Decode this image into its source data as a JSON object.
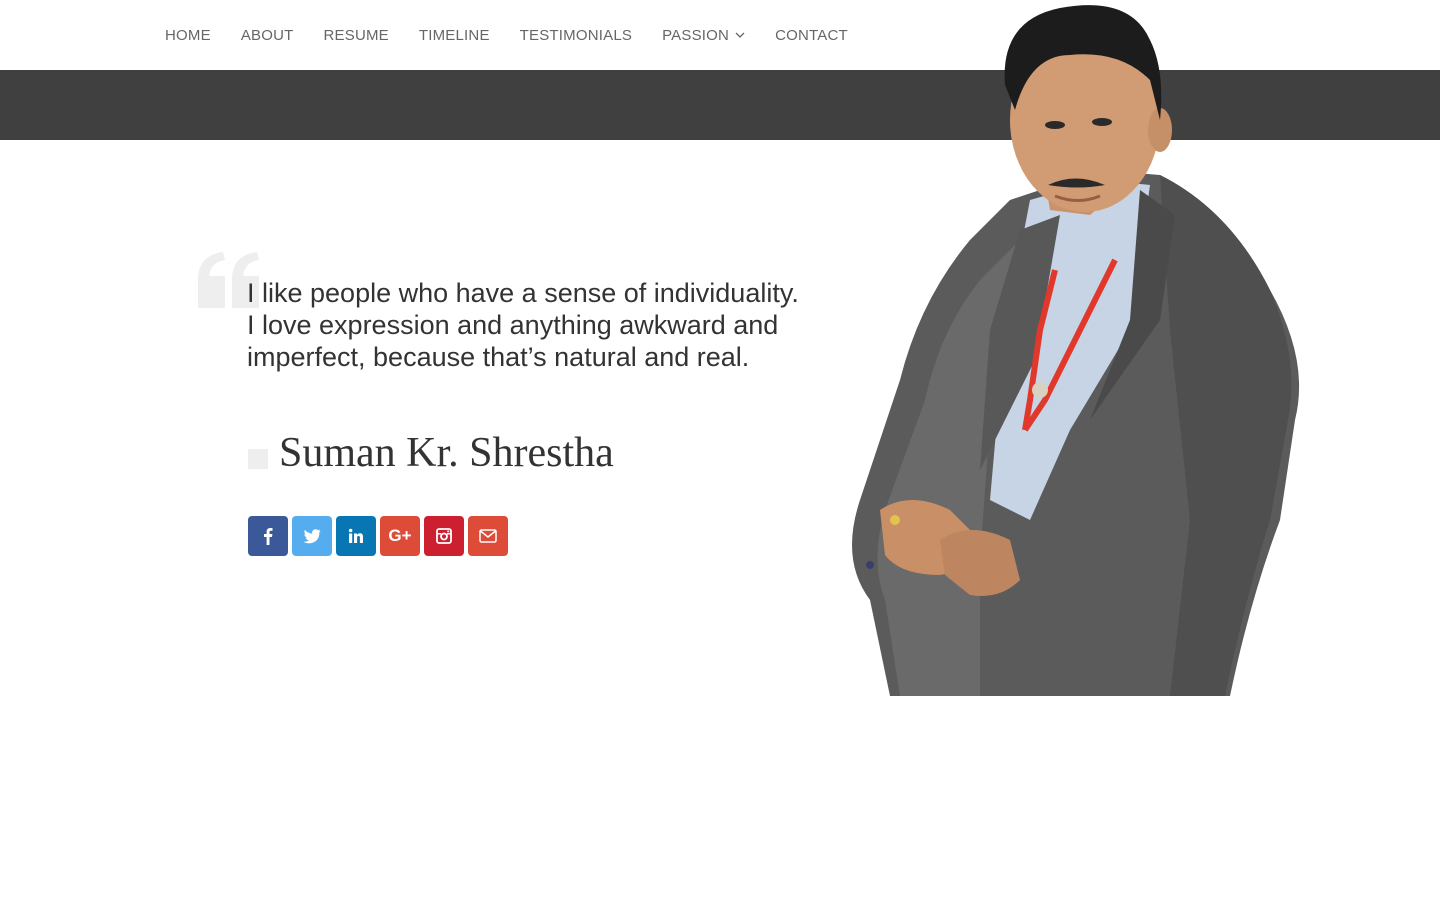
{
  "nav": {
    "items": [
      {
        "label": "HOME"
      },
      {
        "label": "ABOUT"
      },
      {
        "label": "RESUME"
      },
      {
        "label": "TIMELINE"
      },
      {
        "label": "TESTIMONIALS"
      },
      {
        "label": "PASSION",
        "has_dropdown": true
      },
      {
        "label": "CONTACT"
      }
    ]
  },
  "hero": {
    "quote": "I like people who have a sense of individuality. I love expression and anything awkward and imperfect, because that’s natural and real.",
    "author": "Suman Kr. Shrestha"
  },
  "social": {
    "items": [
      {
        "name": "facebook",
        "icon": "facebook-icon",
        "color": "#3b5998"
      },
      {
        "name": "twitter",
        "icon": "twitter-icon",
        "color": "#55acee"
      },
      {
        "name": "linkedin",
        "icon": "linkedin-icon",
        "color": "#0976b4"
      },
      {
        "name": "google-plus",
        "icon": "google-plus-icon",
        "color": "#dd4b39",
        "label": "G+"
      },
      {
        "name": "instagram",
        "icon": "instagram-icon",
        "color": "#cc1f30"
      },
      {
        "name": "email",
        "icon": "envelope-icon",
        "color": "#dd4b39"
      }
    ]
  },
  "colors": {
    "nav_text": "#666666",
    "dark_band": "#404040",
    "quote_text": "#333333",
    "quote_mark": "#eeeeee"
  }
}
